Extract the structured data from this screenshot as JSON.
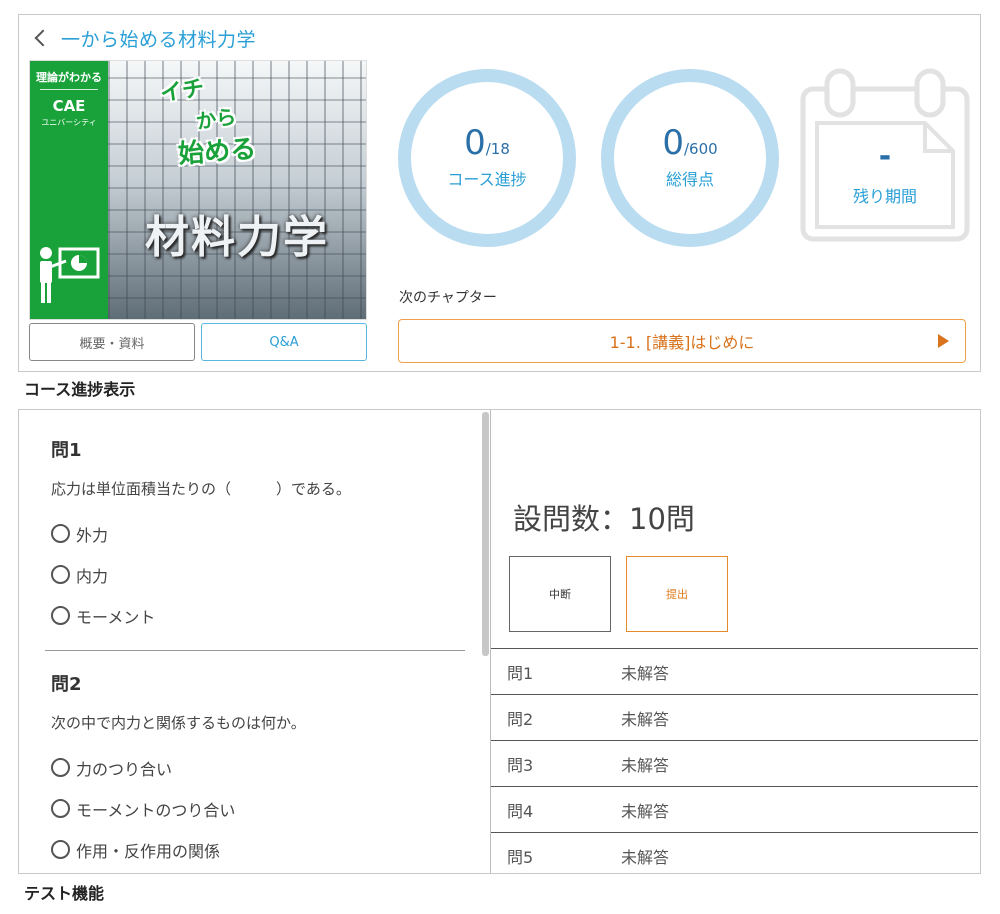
{
  "course": {
    "back_icon": "chevron-left-icon",
    "title": "一から始める材料力学",
    "thumbnail": {
      "brand_line1": "理論がわかる",
      "brand_line2": "CAE",
      "brand_line3": "ユニバーシティ",
      "sub1": "イチ",
      "sub2": "から",
      "sub3": "始める",
      "main_title": "材料力学",
      "teacher_icon": "teacher-presentation-icon"
    },
    "tabs": {
      "overview": "概要・資料",
      "qa": "Q&A"
    },
    "progress": {
      "value": "0",
      "total": "/18",
      "label": "コース進捗"
    },
    "score": {
      "value": "0",
      "total": "/600",
      "label": "総得点"
    },
    "remaining": {
      "value": "-",
      "label": "残り期間",
      "icon": "calendar-icon"
    },
    "next_chapter_label": "次のチャプター",
    "next_chapter": "1-1. [講義]はじめに",
    "play_icon": "play-icon"
  },
  "captions": {
    "course": "コース進捗表示",
    "test": "テスト機能"
  },
  "test": {
    "questions": [
      {
        "title": "問1",
        "text": "応力は単位面積当たりの（　　　）である。",
        "options": [
          "外力",
          "内力",
          "モーメント"
        ]
      },
      {
        "title": "問2",
        "text": "次の中で内力と関係するものは何か。",
        "options": [
          "力のつり合い",
          "モーメントのつり合い",
          "作用・反作用の関係"
        ]
      }
    ],
    "count_text": "設問数：10問",
    "pause_label": "中断",
    "submit_label": "提出",
    "status": [
      {
        "q": "問1",
        "s": "未解答"
      },
      {
        "q": "問2",
        "s": "未解答"
      },
      {
        "q": "問3",
        "s": "未解答"
      },
      {
        "q": "問4",
        "s": "未解答"
      },
      {
        "q": "問5",
        "s": "未解答"
      }
    ]
  },
  "colors": {
    "accent_blue": "#2a9fd6",
    "ring_blue": "#b9dcf0",
    "accent_orange": "#d9731c",
    "brand_green": "#1aa23a"
  }
}
